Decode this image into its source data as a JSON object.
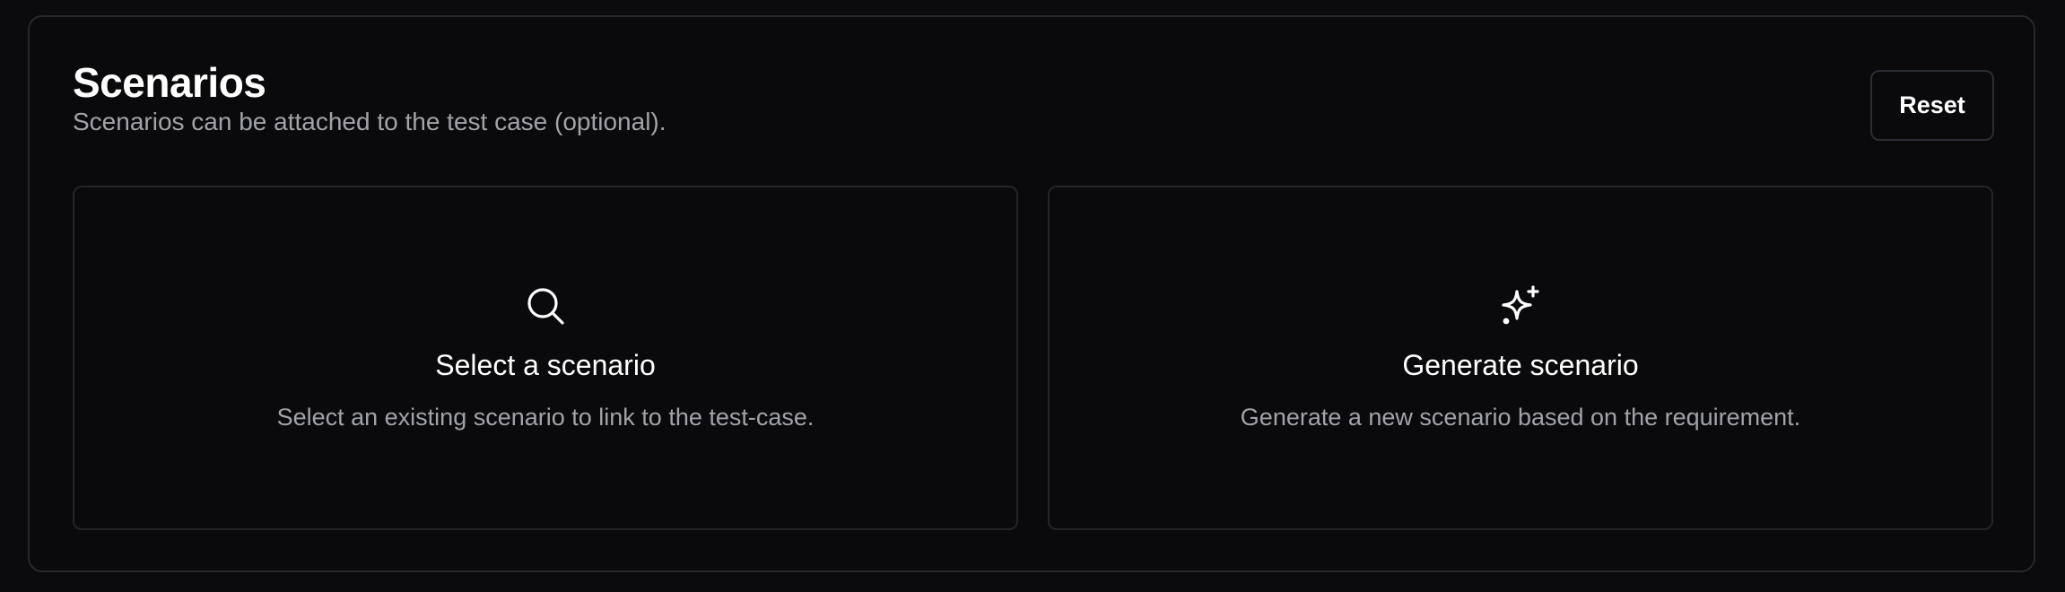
{
  "header": {
    "title": "Scenarios",
    "subtitle": "Scenarios can be attached to the test case (optional).",
    "reset_label": "Reset"
  },
  "options": [
    {
      "icon": "search-icon",
      "title": "Select a scenario",
      "description": "Select an existing scenario to link to the test-case."
    },
    {
      "icon": "sparkles-icon",
      "title": "Generate scenario",
      "description": "Generate a new scenario based on the requirement."
    }
  ],
  "colors": {
    "background": "#0b0b0d",
    "border": "#26282d",
    "text_primary": "#ffffff",
    "text_secondary": "#a1a3a9"
  }
}
